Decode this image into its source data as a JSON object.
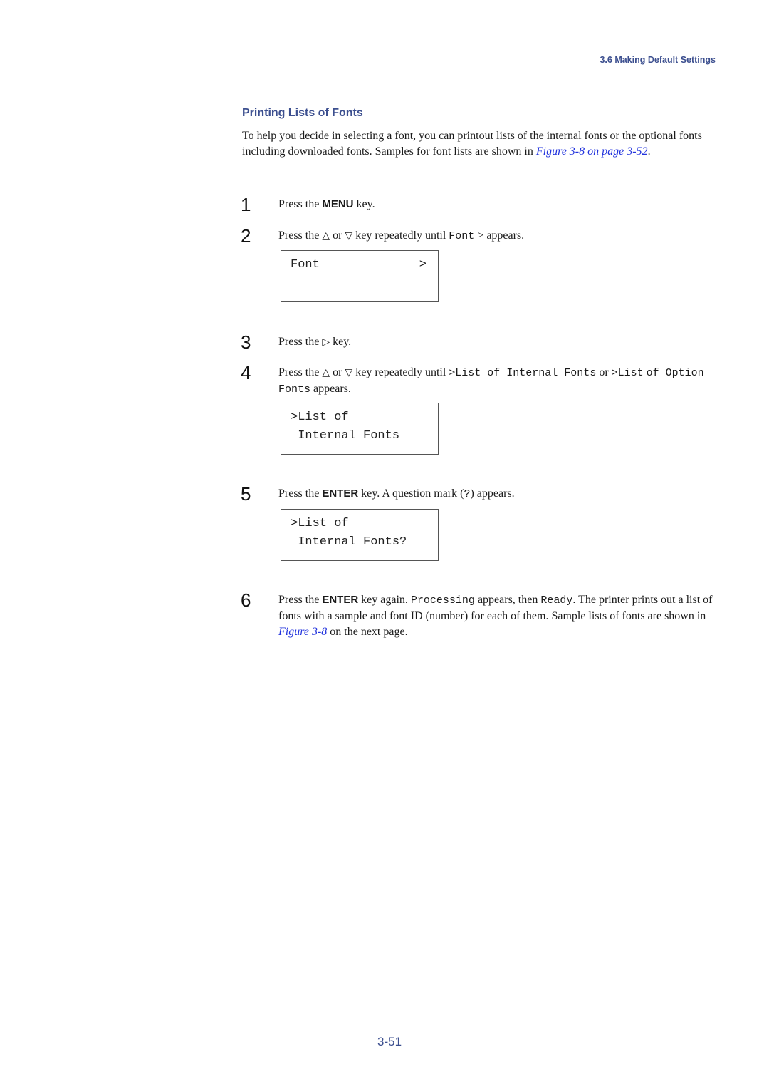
{
  "header": {
    "running_head": "3.6 Making Default Settings"
  },
  "section": {
    "title": "Printing Lists of Fonts",
    "intro_text": "To help you decide in selecting a font, you can printout lists of the internal fonts or the optional fonts including downloaded fonts. Samples for font lists are shown in ",
    "intro_link": "Figure 3-8 on page 3-52",
    "intro_end": "."
  },
  "steps": [
    {
      "number": "1",
      "pre": "Press the ",
      "key": "MENU",
      "post": " key."
    },
    {
      "number": "2",
      "pre": "Press the ",
      "up_icon": "△",
      "or": " or ",
      "down_icon": "▽",
      "mid": " key repeatedly until ",
      "code": "Font",
      "post": " > appears."
    },
    {
      "number": "3",
      "pre": "Press the ",
      "right_icon": "▷",
      "post": " key."
    },
    {
      "number": "4",
      "pre": "Press the ",
      "up_icon": "△",
      "or": " or ",
      "down_icon": "▽",
      "mid": " key repeatedly until ",
      "code1": ">List of Internal Fonts",
      "or2": " or ",
      "code2a": ">List",
      "code2b": "of Option Fonts",
      "post": " appears."
    },
    {
      "number": "5",
      "pre": "Press the ",
      "key": "ENTER",
      "mid": " key. A question mark (",
      "code": "?",
      "post": ") appears."
    },
    {
      "number": "6",
      "pre": "Press the ",
      "key": "ENTER",
      "mid": " key again. ",
      "code1": "Processing",
      "mid2": " appears, then ",
      "code2": "Ready",
      "mid3": ". The printer prints out a list of fonts with a sample and font ID (number) for each of them. Sample lists of fonts are shown in ",
      "link": "Figure 3-8",
      "post": " on the next page."
    }
  ],
  "displays": [
    {
      "line1": "Font",
      "line1_right": ">",
      "line2": ""
    },
    {
      "line1": ">List of",
      "line2": " Internal Fonts"
    },
    {
      "line1": ">List of",
      "line2": " Internal Fonts?"
    }
  ],
  "footer": {
    "page_number": "3-51"
  }
}
